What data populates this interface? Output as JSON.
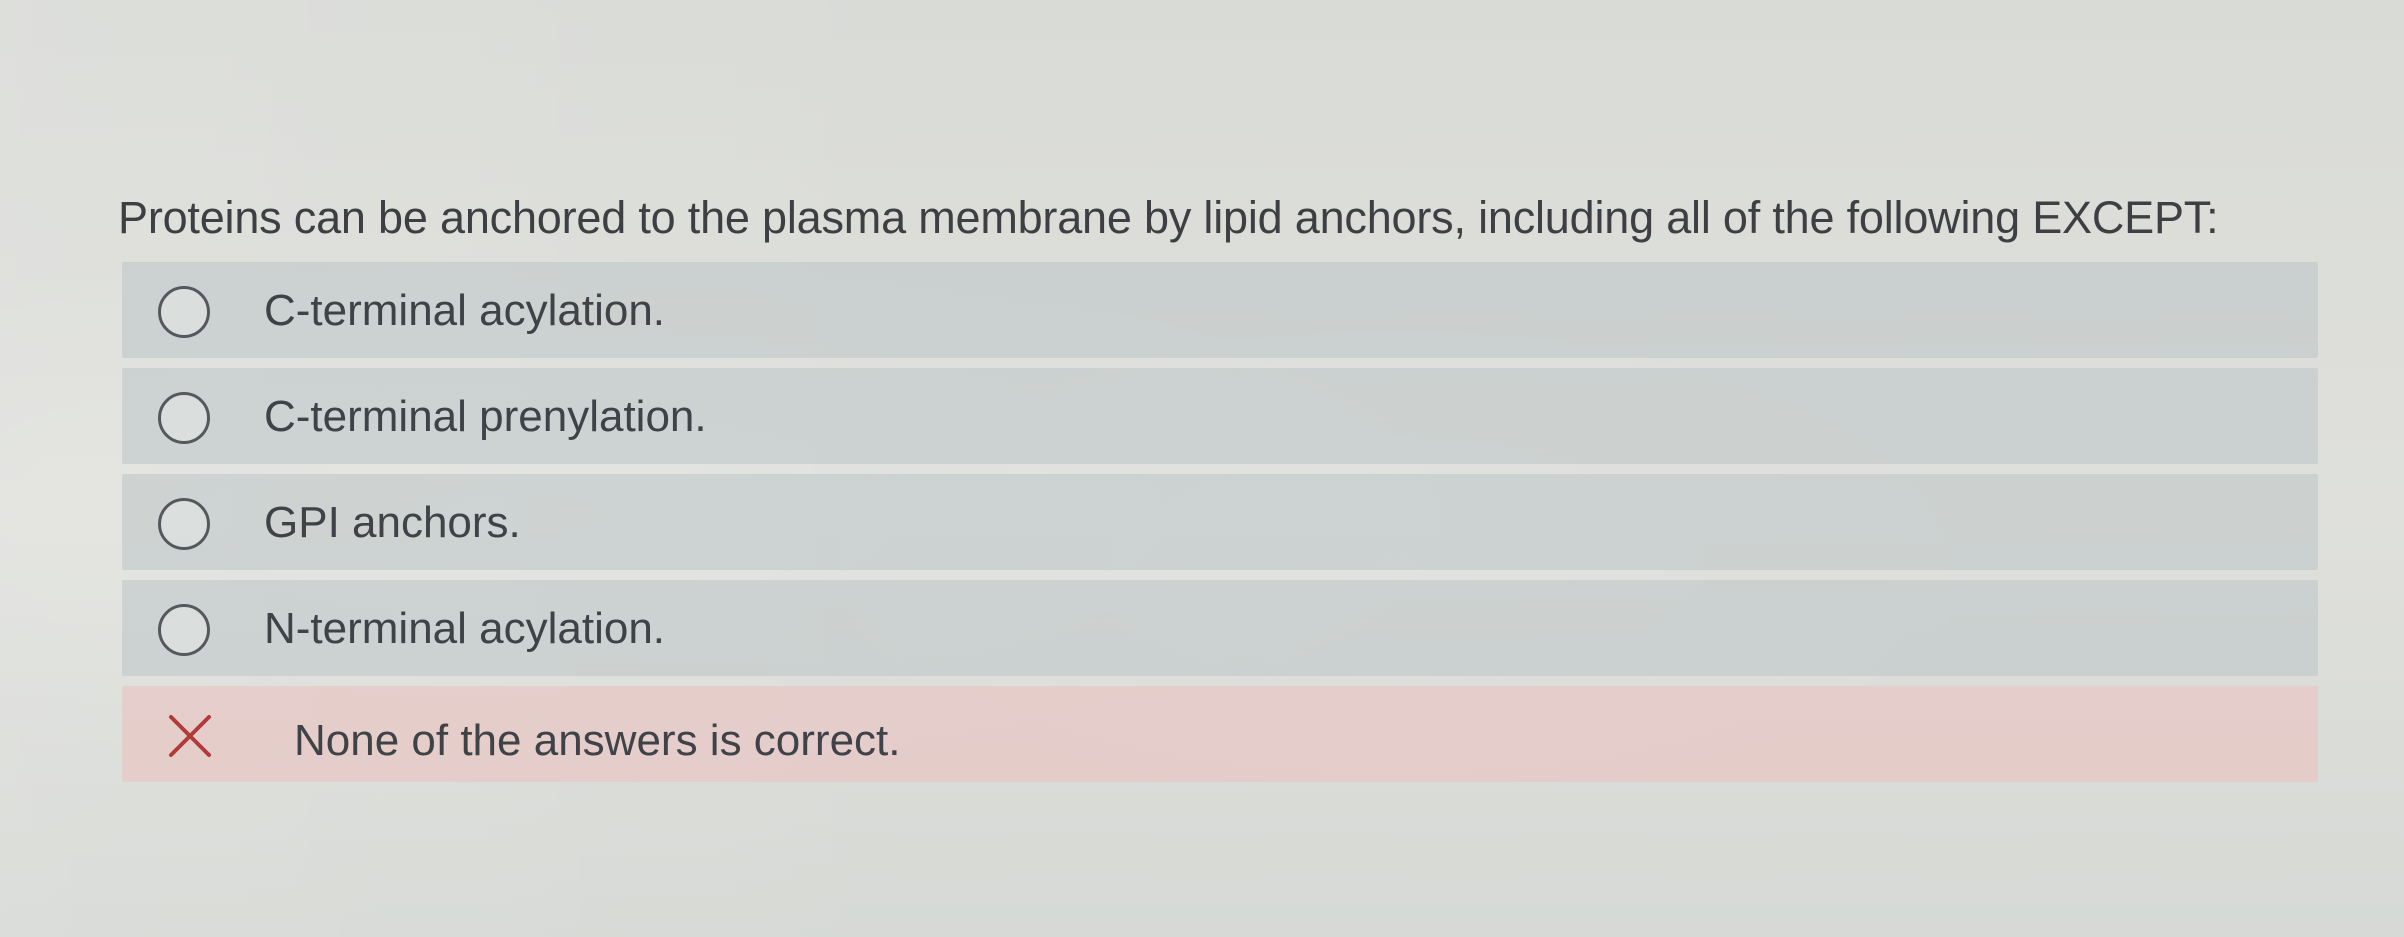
{
  "question": {
    "text": "Proteins can be anchored to the plasma membrane by lipid anchors, including all of the following EXCEPT:"
  },
  "options": [
    {
      "label": "C-terminal acylation.",
      "state": "unselected",
      "icon": "radio-icon"
    },
    {
      "label": "C-terminal prenylation.",
      "state": "unselected",
      "icon": "radio-icon"
    },
    {
      "label": "GPI anchors.",
      "state": "unselected",
      "icon": "radio-icon"
    },
    {
      "label": "N-terminal acylation.",
      "state": "unselected",
      "icon": "radio-icon"
    },
    {
      "label": "None of the answers is correct.",
      "state": "selected-incorrect",
      "icon": "x-icon"
    }
  ],
  "colors": {
    "option_background": "#bcc4c7",
    "incorrect_background": "#e8c6c4",
    "incorrect_mark": "#b23a3a",
    "text": "#3f4246"
  }
}
